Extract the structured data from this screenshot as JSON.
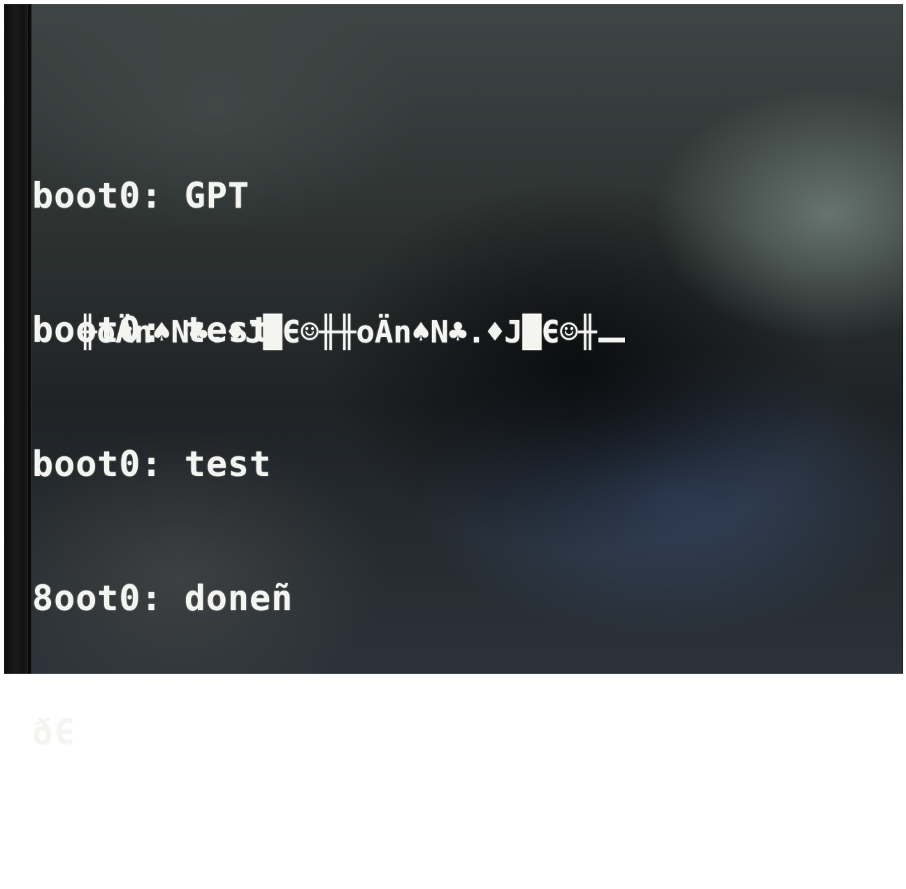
{
  "console": {
    "lines": [
      "boot0: GPT",
      "boot0: test",
      "boot0: test",
      "8oot0: doneñ",
      "ðЄ"
    ],
    "garbage_line": "╫oÄn♠N♣.♦J█Є☺╫╫oÄn♠N♣.♦J█Є☺╫"
  },
  "colors": {
    "text": "#f4f4f0"
  }
}
